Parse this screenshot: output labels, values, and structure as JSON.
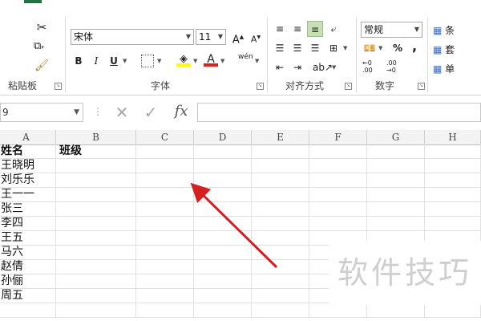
{
  "ribbon": {
    "groups": {
      "clipboard": "粘贴板",
      "font": "字体",
      "alignment": "对齐方式",
      "number": "数字"
    },
    "font_name": "宋体",
    "font_size": "11",
    "number_format": "常规",
    "bold": "B",
    "italic": "I",
    "underline": "U",
    "phonetic": "wén",
    "percent": "%",
    "comma": ",",
    "inc_decimal": "←0 .00",
    "dec_decimal": ".00 →0",
    "right_items": [
      "条",
      "套",
      "单"
    ]
  },
  "formula_bar": {
    "namebox_value": "9",
    "cancel_label": "✕",
    "enter_label": "✓",
    "fx_label": "fx",
    "colon": "⋮",
    "formula_value": ""
  },
  "sheet": {
    "columns": [
      "A",
      "B",
      "C",
      "D",
      "E",
      "F",
      "G",
      "H"
    ],
    "header_row": [
      "姓名",
      "班级"
    ],
    "names": [
      "王晓明",
      "刘乐乐",
      "王一一",
      "张三",
      "李四",
      "王五",
      "马六",
      "赵倩",
      "孙俪",
      "周五"
    ]
  },
  "watermark": "软件技巧",
  "colors": {
    "excel_green": "#217346",
    "arrow_red": "#d42020",
    "selected_align": "#c6e0b4"
  }
}
